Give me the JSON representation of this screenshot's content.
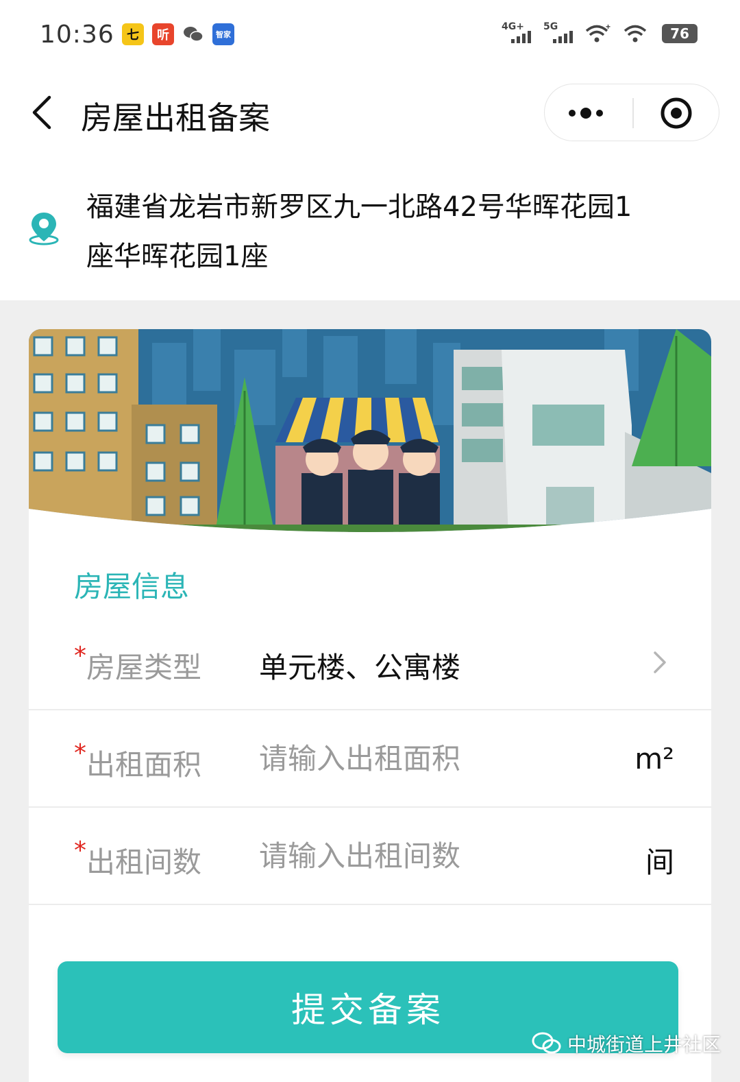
{
  "status_bar": {
    "time": "10:36",
    "app_icons": [
      "七",
      "听",
      "wechat",
      "智家"
    ],
    "network_1": "4G+",
    "network_2": "5G",
    "battery": "76"
  },
  "nav": {
    "title": "房屋出租备案"
  },
  "address": {
    "line1": "福建省龙岩市新罗区九一北路42号华晖花园1",
    "line2": "座华晖花园1座"
  },
  "form": {
    "section_title": "房屋信息",
    "required_mark": "*",
    "rows": [
      {
        "label": "房屋类型",
        "value": "单元楼、公寓楼",
        "placeholder": "",
        "unit": ""
      },
      {
        "label": "出租面积",
        "value": "",
        "placeholder": "请输入出租面积",
        "unit": "m²"
      },
      {
        "label": "出租间数",
        "value": "",
        "placeholder": "请输入出租间数",
        "unit": "间"
      }
    ],
    "submit_label": "提交备案"
  },
  "watermark": {
    "text": "中城街道上井社区"
  },
  "colors": {
    "accent": "#2bc1b9",
    "section_title": "#2bb5b6",
    "required": "#e0261f"
  }
}
